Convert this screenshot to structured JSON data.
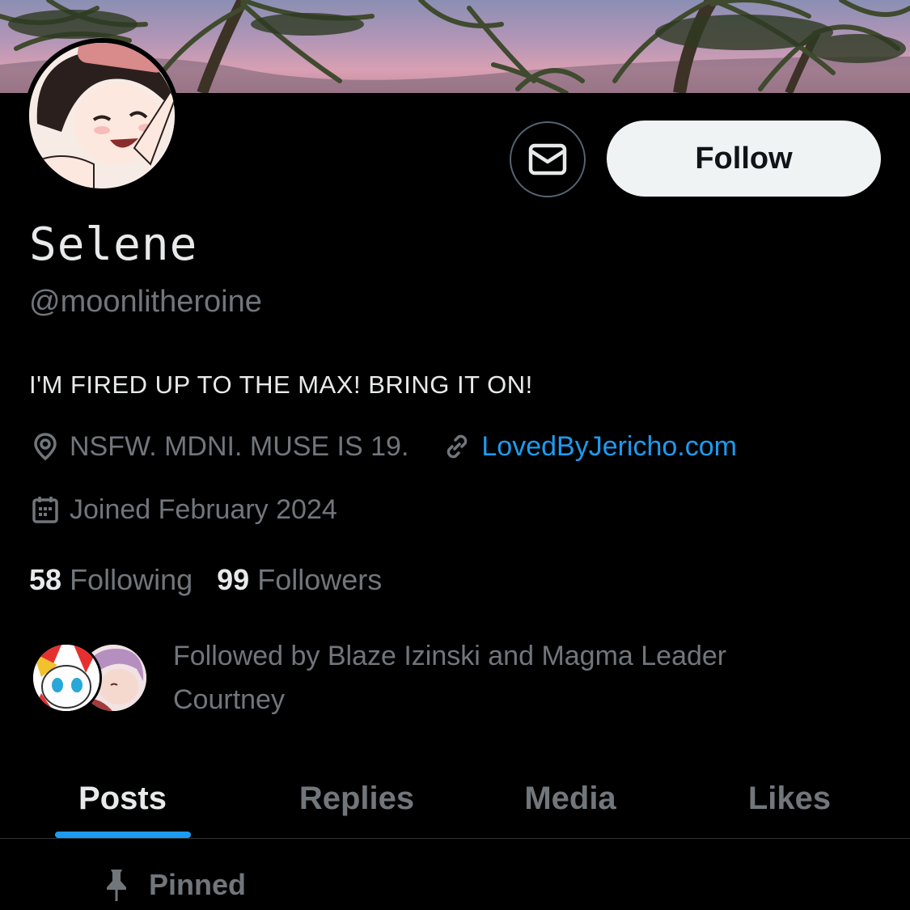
{
  "profile": {
    "name": "Selene",
    "handle": "@moonlitheroine",
    "bio": "I'M FIRED UP TO THE MAX! BRING IT ON!",
    "location": "NSFW. MDNI. MUSE IS 19.",
    "website": "LovedByJericho.com",
    "joined": "Joined February 2024"
  },
  "actions": {
    "follow_label": "Follow",
    "message_icon": "envelope-icon"
  },
  "stats": {
    "following_count": "58",
    "following_label": "Following",
    "followers_count": "99",
    "followers_label": "Followers"
  },
  "followed_by": {
    "text": "Followed by Blaze Izinski and Magma Leader Courtney"
  },
  "tabs": [
    {
      "label": "Posts",
      "active": true
    },
    {
      "label": "Replies",
      "active": false
    },
    {
      "label": "Media",
      "active": false
    },
    {
      "label": "Likes",
      "active": false
    }
  ],
  "pinned": {
    "label": "Pinned"
  },
  "colors": {
    "background": "#000000",
    "accent": "#1d9bf0",
    "text_primary": "#e7e9ea",
    "text_secondary": "#71767b",
    "follow_button": "#eff3f4"
  }
}
